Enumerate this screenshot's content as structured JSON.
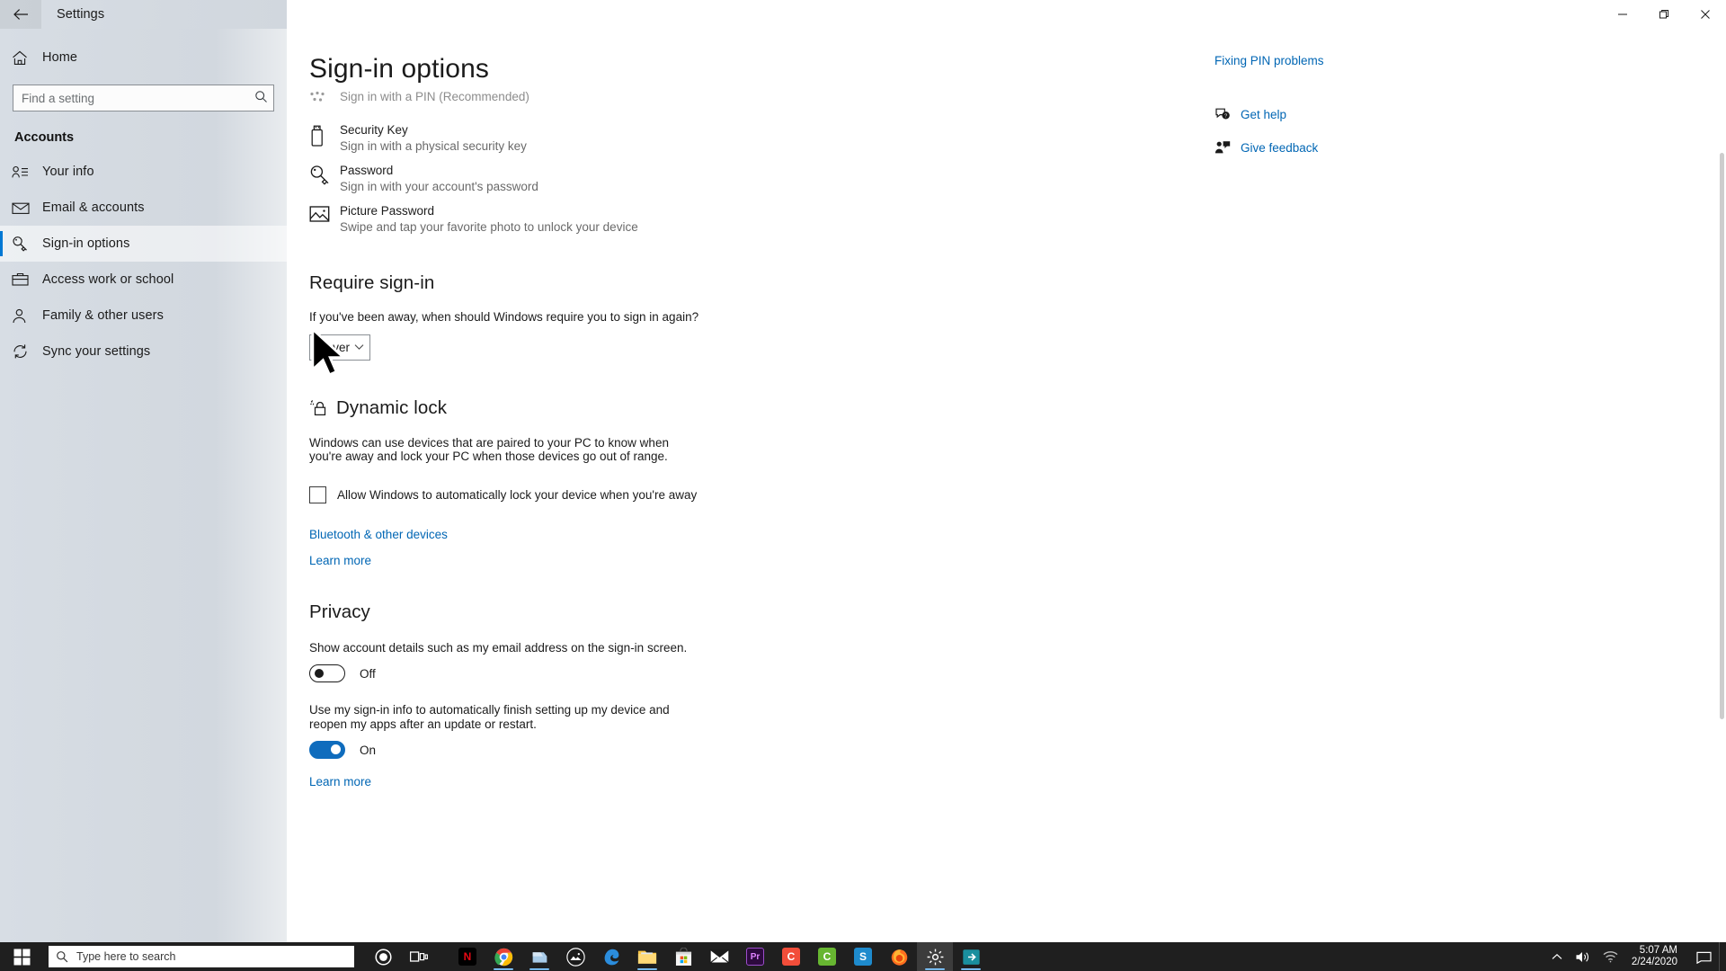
{
  "window": {
    "title": "Settings",
    "back_icon": "back-arrow-icon",
    "minimize_label": "Minimize",
    "maximize_label": "Restore",
    "close_label": "Close"
  },
  "sidebar": {
    "home_label": "Home",
    "home_icon": "home-icon",
    "search": {
      "placeholder": "Find a setting",
      "value": "",
      "icon": "search-icon"
    },
    "section_title": "Accounts",
    "items": [
      {
        "label": "Your info",
        "icon": "user-info-icon",
        "selected": false
      },
      {
        "label": "Email & accounts",
        "icon": "envelope-icon",
        "selected": false
      },
      {
        "label": "Sign-in options",
        "icon": "key-icon",
        "selected": true
      },
      {
        "label": "Access work or school",
        "icon": "briefcase-icon",
        "selected": false
      },
      {
        "label": "Family & other users",
        "icon": "person-icon",
        "selected": false
      },
      {
        "label": "Sync your settings",
        "icon": "sync-icon",
        "selected": false
      }
    ]
  },
  "main": {
    "page_title": "Sign-in options",
    "signin_methods": [
      {
        "icon": "pin-dots-icon",
        "title": "Sign in with a PIN (Recommended)",
        "subtitle": "",
        "disabled": true,
        "single_line": true
      },
      {
        "icon": "usb-security-key-icon",
        "title": "Security Key",
        "subtitle": "Sign in with a physical security key",
        "disabled": false,
        "single_line": false
      },
      {
        "icon": "key-icon",
        "title": "Password",
        "subtitle": "Sign in with your account's password",
        "disabled": false,
        "single_line": false
      },
      {
        "icon": "picture-icon",
        "title": "Picture Password",
        "subtitle": "Swipe and tap your favorite photo to unlock your device",
        "disabled": false,
        "single_line": false
      }
    ],
    "require_signin": {
      "heading": "Require sign-in",
      "description": "If you've been away, when should Windows require you to sign in again?",
      "dropdown_value": "Never",
      "dropdown_icon": "chevron-down-icon"
    },
    "dynamic_lock": {
      "heading": "Dynamic lock",
      "heading_icon": "dynamic-lock-icon",
      "description_line1": "Windows can use devices that are paired to your PC to know when",
      "description_line2": "you're away and lock your PC when those devices go out of range.",
      "checkbox_label": "Allow Windows to automatically lock your device when you're away",
      "checkbox_checked": false,
      "bluetooth_link": "Bluetooth & other devices",
      "learn_more_link": "Learn more"
    },
    "privacy": {
      "heading": "Privacy",
      "setting1_text": "Show account details such as my email address on the sign-in screen.",
      "setting1_state": "Off",
      "setting1_on": false,
      "setting2_line1": "Use my sign-in info to automatically finish setting up my device and",
      "setting2_line2": "reopen my apps after an update or restart.",
      "setting2_state": "On",
      "setting2_on": true,
      "learn_more_link": "Learn more"
    }
  },
  "right_rail": {
    "top_link": "Fixing PIN problems",
    "items": [
      {
        "label": "Get help",
        "icon": "help-chat-icon"
      },
      {
        "label": "Give feedback",
        "icon": "feedback-icon"
      }
    ]
  },
  "taskbar": {
    "start_icon": "windows-start-icon",
    "search": {
      "placeholder": "Type here to search",
      "icon": "search-icon"
    },
    "cortana_icon": "cortana-circle-icon",
    "task_view_icon": "task-view-icon",
    "apps": [
      {
        "name": "Netflix",
        "icon": "netflix-icon",
        "glyph": "N",
        "bg": "#000000",
        "fg": "#e50914",
        "active": false
      },
      {
        "name": "Google Chrome",
        "icon": "chrome-icon",
        "glyph": "",
        "bg": "",
        "fg": "",
        "active": true
      },
      {
        "name": "OneDrive",
        "icon": "onedrive-icon",
        "glyph": "",
        "bg": "",
        "fg": "",
        "active": true
      },
      {
        "name": "Dark App",
        "icon": "mountain-dark-icon",
        "glyph": "",
        "bg": "#1b1b1b",
        "fg": "#ffffff",
        "active": false
      },
      {
        "name": "Microsoft Edge",
        "icon": "edge-icon",
        "glyph": "",
        "bg": "",
        "fg": "",
        "active": false
      },
      {
        "name": "File Explorer",
        "icon": "file-explorer-icon",
        "glyph": "",
        "bg": "",
        "fg": "",
        "active": true
      },
      {
        "name": "Microsoft Store",
        "icon": "store-icon",
        "glyph": "",
        "bg": "",
        "fg": "",
        "active": false
      },
      {
        "name": "Mail",
        "icon": "mail-icon",
        "glyph": "",
        "bg": "",
        "fg": "",
        "active": false
      },
      {
        "name": "Premiere Pro",
        "icon": "premiere-pro-icon",
        "glyph": "Pr",
        "bg": "#2d0a3e",
        "fg": "#e083ff",
        "active": false
      },
      {
        "name": "Camtasia",
        "icon": "camtasia-icon",
        "glyph": "C",
        "bg": "#f24e3a",
        "fg": "#ffffff",
        "active": false
      },
      {
        "name": "Camtasia Green",
        "icon": "camtasia-green-icon",
        "glyph": "C",
        "bg": "#67b631",
        "fg": "#ffffff",
        "active": false
      },
      {
        "name": "Snagit",
        "icon": "snagit-icon",
        "glyph": "S",
        "bg": "#1e8bcd",
        "fg": "#ffffff",
        "active": false
      },
      {
        "name": "Mozilla Firefox",
        "icon": "firefox-icon",
        "glyph": "",
        "bg": "",
        "fg": "",
        "active": false
      },
      {
        "name": "Settings",
        "icon": "settings-gear-icon",
        "glyph": "",
        "bg": "",
        "fg": "",
        "active": true
      },
      {
        "name": "Teams",
        "icon": "teal-app-icon",
        "glyph": "",
        "bg": "#1a8f9e",
        "fg": "#ffffff",
        "active": true
      }
    ],
    "tray": {
      "chevron_icon": "chevron-up-icon",
      "volume_icon": "volume-icon",
      "network_icon": "wifi-icon",
      "time": "5:07 AM",
      "date": "2/24/2020",
      "action_center_icon": "action-center-icon"
    }
  }
}
